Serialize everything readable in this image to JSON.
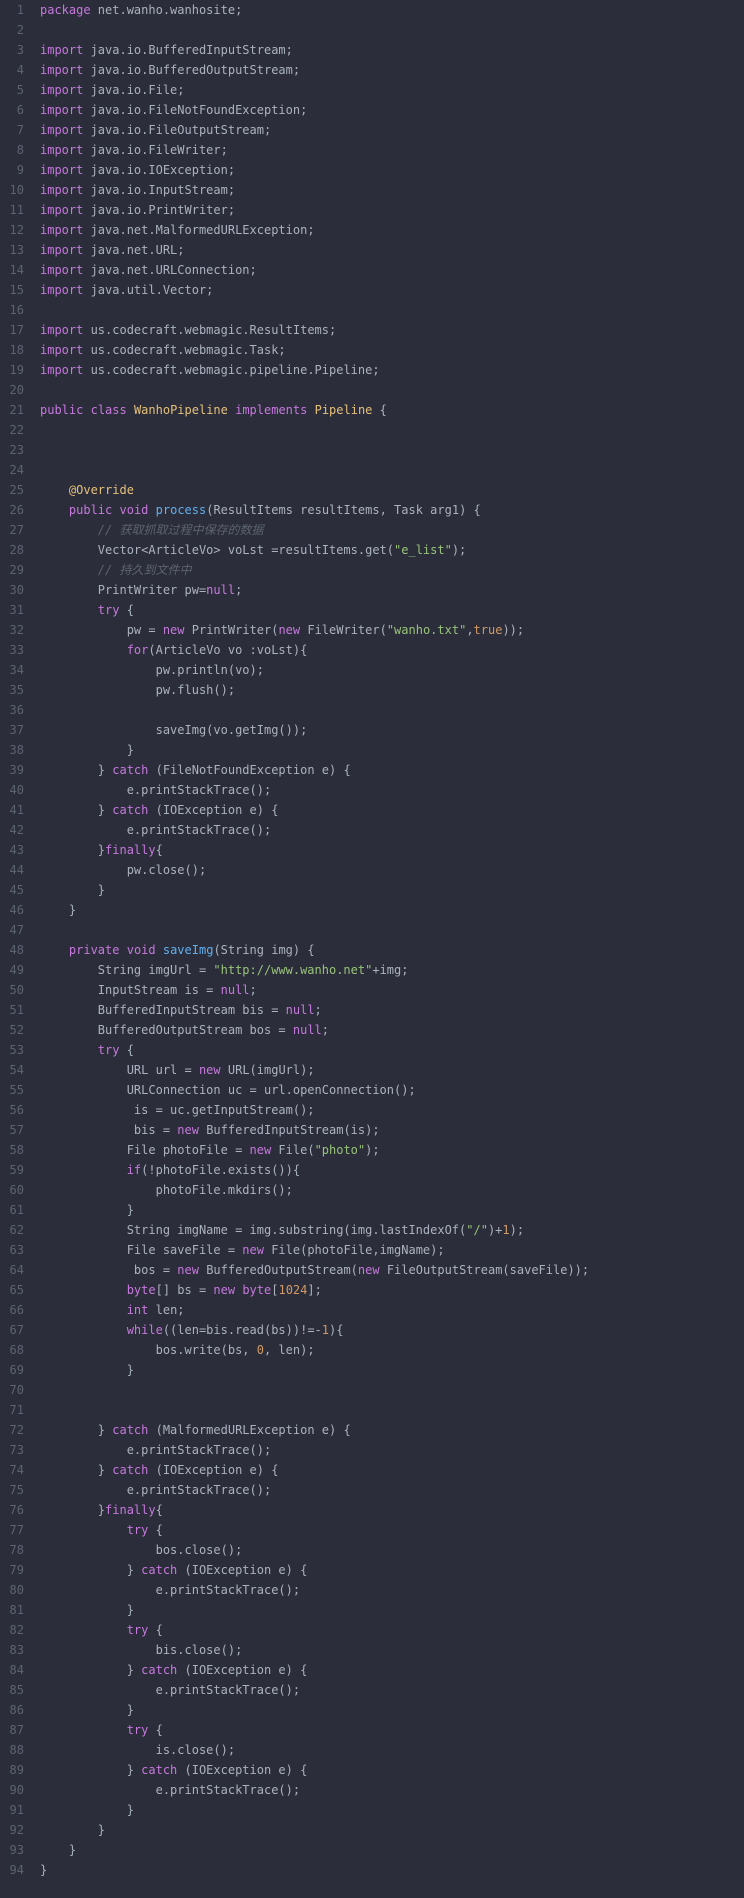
{
  "lines": [
    {
      "n": 1,
      "tokens": [
        [
          "kw",
          "package"
        ],
        [
          "plain",
          " net.wanho.wanhosite;"
        ]
      ]
    },
    {
      "n": 2,
      "tokens": []
    },
    {
      "n": 3,
      "tokens": [
        [
          "kw",
          "import"
        ],
        [
          "plain",
          " java.io.BufferedInputStream;"
        ]
      ]
    },
    {
      "n": 4,
      "tokens": [
        [
          "kw",
          "import"
        ],
        [
          "plain",
          " java.io.BufferedOutputStream;"
        ]
      ]
    },
    {
      "n": 5,
      "tokens": [
        [
          "kw",
          "import"
        ],
        [
          "plain",
          " java.io.File;"
        ]
      ]
    },
    {
      "n": 6,
      "tokens": [
        [
          "kw",
          "import"
        ],
        [
          "plain",
          " java.io.FileNotFoundException;"
        ]
      ]
    },
    {
      "n": 7,
      "tokens": [
        [
          "kw",
          "import"
        ],
        [
          "plain",
          " java.io.FileOutputStream;"
        ]
      ]
    },
    {
      "n": 8,
      "tokens": [
        [
          "kw",
          "import"
        ],
        [
          "plain",
          " java.io.FileWriter;"
        ]
      ]
    },
    {
      "n": 9,
      "tokens": [
        [
          "kw",
          "import"
        ],
        [
          "plain",
          " java.io.IOException;"
        ]
      ]
    },
    {
      "n": 10,
      "tokens": [
        [
          "kw",
          "import"
        ],
        [
          "plain",
          " java.io.InputStream;"
        ]
      ]
    },
    {
      "n": 11,
      "tokens": [
        [
          "kw",
          "import"
        ],
        [
          "plain",
          " java.io.PrintWriter;"
        ]
      ]
    },
    {
      "n": 12,
      "tokens": [
        [
          "kw",
          "import"
        ],
        [
          "plain",
          " java.net.MalformedURLException;"
        ]
      ]
    },
    {
      "n": 13,
      "tokens": [
        [
          "kw",
          "import"
        ],
        [
          "plain",
          " java.net.URL;"
        ]
      ]
    },
    {
      "n": 14,
      "tokens": [
        [
          "kw",
          "import"
        ],
        [
          "plain",
          " java.net.URLConnection;"
        ]
      ]
    },
    {
      "n": 15,
      "tokens": [
        [
          "kw",
          "import"
        ],
        [
          "plain",
          " java.util.Vector;"
        ]
      ]
    },
    {
      "n": 16,
      "tokens": []
    },
    {
      "n": 17,
      "tokens": [
        [
          "kw",
          "import"
        ],
        [
          "plain",
          " us.codecraft.webmagic.ResultItems;"
        ]
      ]
    },
    {
      "n": 18,
      "tokens": [
        [
          "kw",
          "import"
        ],
        [
          "plain",
          " us.codecraft.webmagic.Task;"
        ]
      ]
    },
    {
      "n": 19,
      "tokens": [
        [
          "kw",
          "import"
        ],
        [
          "plain",
          " us.codecraft.webmagic.pipeline.Pipeline;"
        ]
      ]
    },
    {
      "n": 20,
      "tokens": []
    },
    {
      "n": 21,
      "tokens": [
        [
          "kw",
          "public"
        ],
        [
          "plain",
          " "
        ],
        [
          "kw",
          "class"
        ],
        [
          "plain",
          " "
        ],
        [
          "type",
          "WanhoPipeline"
        ],
        [
          "plain",
          " "
        ],
        [
          "kw",
          "implements"
        ],
        [
          "plain",
          " "
        ],
        [
          "type",
          "Pipeline"
        ],
        [
          "plain",
          " {"
        ]
      ]
    },
    {
      "n": 22,
      "tokens": []
    },
    {
      "n": 23,
      "tokens": []
    },
    {
      "n": 24,
      "tokens": []
    },
    {
      "n": 25,
      "tokens": [
        [
          "plain",
          "    "
        ],
        [
          "annotation",
          "@Override"
        ]
      ]
    },
    {
      "n": 26,
      "tokens": [
        [
          "plain",
          "    "
        ],
        [
          "kw",
          "public"
        ],
        [
          "plain",
          " "
        ],
        [
          "kw",
          "void"
        ],
        [
          "plain",
          " "
        ],
        [
          "method",
          "process"
        ],
        [
          "plain",
          "(ResultItems resultItems, Task arg1) {"
        ]
      ]
    },
    {
      "n": 27,
      "tokens": [
        [
          "plain",
          "        "
        ],
        [
          "comment",
          "// 获取抓取过程中保存的数据"
        ]
      ]
    },
    {
      "n": 28,
      "tokens": [
        [
          "plain",
          "        Vector<ArticleVo> voLst =resultItems.get("
        ],
        [
          "str",
          "\"e_list\""
        ],
        [
          "plain",
          ");"
        ]
      ]
    },
    {
      "n": 29,
      "tokens": [
        [
          "plain",
          "        "
        ],
        [
          "comment",
          "// 持久到文件中"
        ]
      ]
    },
    {
      "n": 30,
      "tokens": [
        [
          "plain",
          "        PrintWriter pw="
        ],
        [
          "kw",
          "null"
        ],
        [
          "plain",
          ";"
        ]
      ]
    },
    {
      "n": 31,
      "tokens": [
        [
          "plain",
          "        "
        ],
        [
          "kw",
          "try"
        ],
        [
          "plain",
          " {"
        ]
      ]
    },
    {
      "n": 32,
      "tokens": [
        [
          "plain",
          "            pw = "
        ],
        [
          "kw",
          "new"
        ],
        [
          "plain",
          " PrintWriter("
        ],
        [
          "kw",
          "new"
        ],
        [
          "plain",
          " FileWriter("
        ],
        [
          "str",
          "\"wanho.txt\""
        ],
        [
          "plain",
          ","
        ],
        [
          "bool",
          "true"
        ],
        [
          "plain",
          "));"
        ]
      ]
    },
    {
      "n": 33,
      "tokens": [
        [
          "plain",
          "            "
        ],
        [
          "kw",
          "for"
        ],
        [
          "plain",
          "(ArticleVo vo :voLst){"
        ]
      ]
    },
    {
      "n": 34,
      "tokens": [
        [
          "plain",
          "                pw.println(vo);"
        ]
      ]
    },
    {
      "n": 35,
      "tokens": [
        [
          "plain",
          "                pw.flush();"
        ]
      ]
    },
    {
      "n": 36,
      "tokens": []
    },
    {
      "n": 37,
      "tokens": [
        [
          "plain",
          "                saveImg(vo.getImg());"
        ]
      ]
    },
    {
      "n": 38,
      "tokens": [
        [
          "plain",
          "            }"
        ]
      ]
    },
    {
      "n": 39,
      "tokens": [
        [
          "plain",
          "        } "
        ],
        [
          "kw",
          "catch"
        ],
        [
          "plain",
          " (FileNotFoundException e) {"
        ]
      ]
    },
    {
      "n": 40,
      "tokens": [
        [
          "plain",
          "            e.printStackTrace();"
        ]
      ]
    },
    {
      "n": 41,
      "tokens": [
        [
          "plain",
          "        } "
        ],
        [
          "kw",
          "catch"
        ],
        [
          "plain",
          " (IOException e) {"
        ]
      ]
    },
    {
      "n": 42,
      "tokens": [
        [
          "plain",
          "            e.printStackTrace();"
        ]
      ]
    },
    {
      "n": 43,
      "tokens": [
        [
          "plain",
          "        }"
        ],
        [
          "kw",
          "finally"
        ],
        [
          "plain",
          "{"
        ]
      ]
    },
    {
      "n": 44,
      "tokens": [
        [
          "plain",
          "            pw.close();"
        ]
      ]
    },
    {
      "n": 45,
      "tokens": [
        [
          "plain",
          "        }"
        ]
      ]
    },
    {
      "n": 46,
      "tokens": [
        [
          "plain",
          "    }"
        ]
      ]
    },
    {
      "n": 47,
      "tokens": []
    },
    {
      "n": 48,
      "tokens": [
        [
          "plain",
          "    "
        ],
        [
          "kw",
          "private"
        ],
        [
          "plain",
          " "
        ],
        [
          "kw",
          "void"
        ],
        [
          "plain",
          " "
        ],
        [
          "method",
          "saveImg"
        ],
        [
          "plain",
          "(String img) {"
        ]
      ]
    },
    {
      "n": 49,
      "tokens": [
        [
          "plain",
          "        String imgUrl = "
        ],
        [
          "str",
          "\"http://www.wanho.net\""
        ],
        [
          "plain",
          "+img;"
        ]
      ]
    },
    {
      "n": 50,
      "tokens": [
        [
          "plain",
          "        InputStream is = "
        ],
        [
          "kw",
          "null"
        ],
        [
          "plain",
          ";"
        ]
      ]
    },
    {
      "n": 51,
      "tokens": [
        [
          "plain",
          "        BufferedInputStream bis = "
        ],
        [
          "kw",
          "null"
        ],
        [
          "plain",
          ";"
        ]
      ]
    },
    {
      "n": 52,
      "tokens": [
        [
          "plain",
          "        BufferedOutputStream bos = "
        ],
        [
          "kw",
          "null"
        ],
        [
          "plain",
          ";"
        ]
      ]
    },
    {
      "n": 53,
      "tokens": [
        [
          "plain",
          "        "
        ],
        [
          "kw",
          "try"
        ],
        [
          "plain",
          " {"
        ]
      ]
    },
    {
      "n": 54,
      "tokens": [
        [
          "plain",
          "            URL url = "
        ],
        [
          "kw",
          "new"
        ],
        [
          "plain",
          " URL(imgUrl);"
        ]
      ]
    },
    {
      "n": 55,
      "tokens": [
        [
          "plain",
          "            URLConnection uc = url.openConnection();"
        ]
      ]
    },
    {
      "n": 56,
      "tokens": [
        [
          "plain",
          "             is = uc.getInputStream();"
        ]
      ]
    },
    {
      "n": 57,
      "tokens": [
        [
          "plain",
          "             bis = "
        ],
        [
          "kw",
          "new"
        ],
        [
          "plain",
          " BufferedInputStream(is);"
        ]
      ]
    },
    {
      "n": 58,
      "tokens": [
        [
          "plain",
          "            File photoFile = "
        ],
        [
          "kw",
          "new"
        ],
        [
          "plain",
          " File("
        ],
        [
          "str",
          "\"photo\""
        ],
        [
          "plain",
          ");"
        ]
      ]
    },
    {
      "n": 59,
      "tokens": [
        [
          "plain",
          "            "
        ],
        [
          "kw",
          "if"
        ],
        [
          "plain",
          "(!photoFile.exists()){"
        ]
      ]
    },
    {
      "n": 60,
      "tokens": [
        [
          "plain",
          "                photoFile.mkdirs();"
        ]
      ]
    },
    {
      "n": 61,
      "tokens": [
        [
          "plain",
          "            }"
        ]
      ]
    },
    {
      "n": 61,
      "tokens": [
        [
          "plain",
          "            }"
        ]
      ]
    },
    {
      "n": 62,
      "tokens": [
        [
          "plain",
          "            String imgName = img.substring(img.lastIndexOf("
        ],
        [
          "str",
          "\"/\""
        ],
        [
          "plain",
          ")+"
        ],
        [
          "num",
          "1"
        ],
        [
          "plain",
          ");"
        ]
      ]
    },
    {
      "n": 63,
      "tokens": [
        [
          "plain",
          "            File saveFile = "
        ],
        [
          "kw",
          "new"
        ],
        [
          "plain",
          " File(photoFile,imgName);"
        ]
      ]
    },
    {
      "n": 64,
      "tokens": [
        [
          "plain",
          "             bos = "
        ],
        [
          "kw",
          "new"
        ],
        [
          "plain",
          " BufferedOutputStream("
        ],
        [
          "kw",
          "new"
        ],
        [
          "plain",
          " FileOutputStream(saveFile));"
        ]
      ]
    },
    {
      "n": 65,
      "tokens": [
        [
          "plain",
          "            "
        ],
        [
          "kw",
          "byte"
        ],
        [
          "plain",
          "[] bs = "
        ],
        [
          "kw",
          "new"
        ],
        [
          "plain",
          " "
        ],
        [
          "kw",
          "byte"
        ],
        [
          "plain",
          "["
        ],
        [
          "num",
          "1024"
        ],
        [
          "plain",
          "];"
        ]
      ]
    },
    {
      "n": 66,
      "tokens": [
        [
          "plain",
          "            "
        ],
        [
          "kw",
          "int"
        ],
        [
          "plain",
          " len;"
        ]
      ]
    },
    {
      "n": 67,
      "tokens": [
        [
          "plain",
          "            "
        ],
        [
          "kw",
          "while"
        ],
        [
          "plain",
          "((len=bis.read(bs))!=-"
        ],
        [
          "num",
          "1"
        ],
        [
          "plain",
          "){"
        ]
      ]
    },
    {
      "n": 68,
      "tokens": [
        [
          "plain",
          "                bos.write(bs, "
        ],
        [
          "num",
          "0"
        ],
        [
          "plain",
          ", len);"
        ]
      ]
    },
    {
      "n": 69,
      "tokens": [
        [
          "plain",
          "            }"
        ]
      ]
    },
    {
      "n": 70,
      "tokens": []
    },
    {
      "n": 71,
      "tokens": []
    },
    {
      "n": 72,
      "tokens": [
        [
          "plain",
          "        } "
        ],
        [
          "kw",
          "catch"
        ],
        [
          "plain",
          " (MalformedURLException e) {"
        ]
      ]
    },
    {
      "n": 73,
      "tokens": [
        [
          "plain",
          "            e.printStackTrace();"
        ]
      ]
    },
    {
      "n": 74,
      "tokens": [
        [
          "plain",
          "        } "
        ],
        [
          "kw",
          "catch"
        ],
        [
          "plain",
          " (IOException e) {"
        ]
      ]
    },
    {
      "n": 75,
      "tokens": [
        [
          "plain",
          "            e.printStackTrace();"
        ]
      ]
    },
    {
      "n": 76,
      "tokens": [
        [
          "plain",
          "        }"
        ],
        [
          "kw",
          "finally"
        ],
        [
          "plain",
          "{"
        ]
      ]
    },
    {
      "n": 77,
      "tokens": [
        [
          "plain",
          "            "
        ],
        [
          "kw",
          "try"
        ],
        [
          "plain",
          " {"
        ]
      ]
    },
    {
      "n": 78,
      "tokens": [
        [
          "plain",
          "                bos.close();"
        ]
      ]
    },
    {
      "n": 79,
      "tokens": [
        [
          "plain",
          "            } "
        ],
        [
          "kw",
          "catch"
        ],
        [
          "plain",
          " (IOException e) {"
        ]
      ]
    },
    {
      "n": 80,
      "tokens": [
        [
          "plain",
          "                e.printStackTrace();"
        ]
      ]
    },
    {
      "n": 81,
      "tokens": [
        [
          "plain",
          "            }"
        ]
      ]
    },
    {
      "n": 82,
      "tokens": [
        [
          "plain",
          "            "
        ],
        [
          "kw",
          "try"
        ],
        [
          "plain",
          " {"
        ]
      ]
    },
    {
      "n": 83,
      "tokens": [
        [
          "plain",
          "                bis.close();"
        ]
      ]
    },
    {
      "n": 84,
      "tokens": [
        [
          "plain",
          "            } "
        ],
        [
          "kw",
          "catch"
        ],
        [
          "plain",
          " (IOException e) {"
        ]
      ]
    },
    {
      "n": 85,
      "tokens": [
        [
          "plain",
          "                e.printStackTrace();"
        ]
      ]
    },
    {
      "n": 86,
      "tokens": [
        [
          "plain",
          "            }"
        ]
      ]
    },
    {
      "n": 87,
      "tokens": [
        [
          "plain",
          "            "
        ],
        [
          "kw",
          "try"
        ],
        [
          "plain",
          " {"
        ]
      ]
    },
    {
      "n": 88,
      "tokens": [
        [
          "plain",
          "                is.close();"
        ]
      ]
    },
    {
      "n": 89,
      "tokens": [
        [
          "plain",
          "            } "
        ],
        [
          "kw",
          "catch"
        ],
        [
          "plain",
          " (IOException e) {"
        ]
      ]
    },
    {
      "n": 90,
      "tokens": [
        [
          "plain",
          "                e.printStackTrace();"
        ]
      ]
    },
    {
      "n": 91,
      "tokens": [
        [
          "plain",
          "            }"
        ]
      ]
    },
    {
      "n": 92,
      "tokens": [
        [
          "plain",
          "        }"
        ]
      ]
    },
    {
      "n": 93,
      "tokens": [
        [
          "plain",
          "    }"
        ]
      ]
    },
    {
      "n": 94,
      "tokens": [
        [
          "plain",
          "}"
        ]
      ]
    }
  ]
}
